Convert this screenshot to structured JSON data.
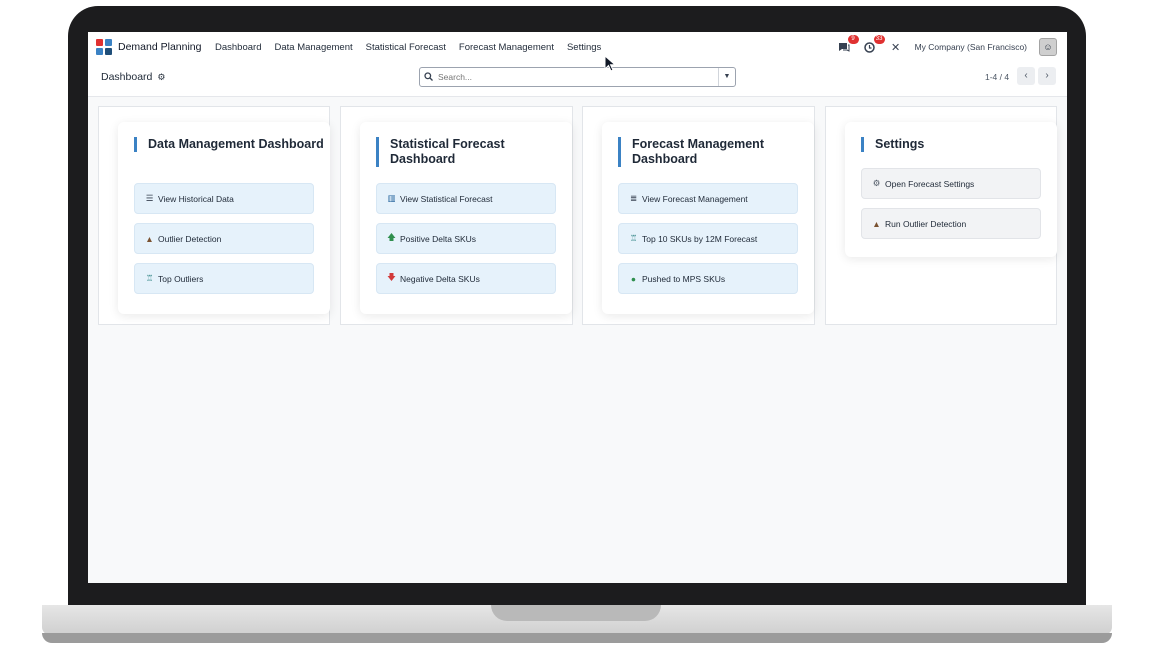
{
  "app": {
    "name": "Demand Planning",
    "menu": [
      "Dashboard",
      "Data Management",
      "Statistical Forecast",
      "Forecast Management",
      "Settings"
    ]
  },
  "systray": {
    "messages_badge": "9",
    "activities_badge": "33",
    "company": "My Company (San Francisco)"
  },
  "control": {
    "breadcrumb": "Dashboard",
    "search_placeholder": "Search...",
    "pager": "1-4 / 4"
  },
  "cards": [
    {
      "title": "Data Management Dashboard",
      "buttons": [
        {
          "label": "View Historical Data",
          "icon": "database-icon"
        },
        {
          "label": "Outlier Detection",
          "icon": "warning-icon"
        },
        {
          "label": "Top Outliers",
          "icon": "trophy-icon"
        }
      ]
    },
    {
      "title": "Statistical Forecast Dashboard",
      "buttons": [
        {
          "label": "View Statistical Forecast",
          "icon": "bar-chart-icon"
        },
        {
          "label": "Positive Delta SKUs",
          "icon": "arrow-up-icon"
        },
        {
          "label": "Negative Delta SKUs",
          "icon": "arrow-down-icon"
        }
      ]
    },
    {
      "title": "Forecast Management Dashboard",
      "buttons": [
        {
          "label": "View Forecast Management",
          "icon": "list-icon"
        },
        {
          "label": "Top 10 SKUs by 12M Forecast",
          "icon": "trophy-icon"
        },
        {
          "label": "Pushed to MPS SKUs",
          "icon": "check-circle-icon"
        }
      ]
    },
    {
      "title": "Settings",
      "buttons": [
        {
          "label": "Open Forecast Settings",
          "icon": "gears-icon"
        },
        {
          "label": "Run Outlier Detection",
          "icon": "warning-icon"
        }
      ]
    }
  ],
  "colors": {
    "accent": "#3b82c4",
    "button_bg": "#e6f2fb",
    "badge": "#e03131"
  }
}
